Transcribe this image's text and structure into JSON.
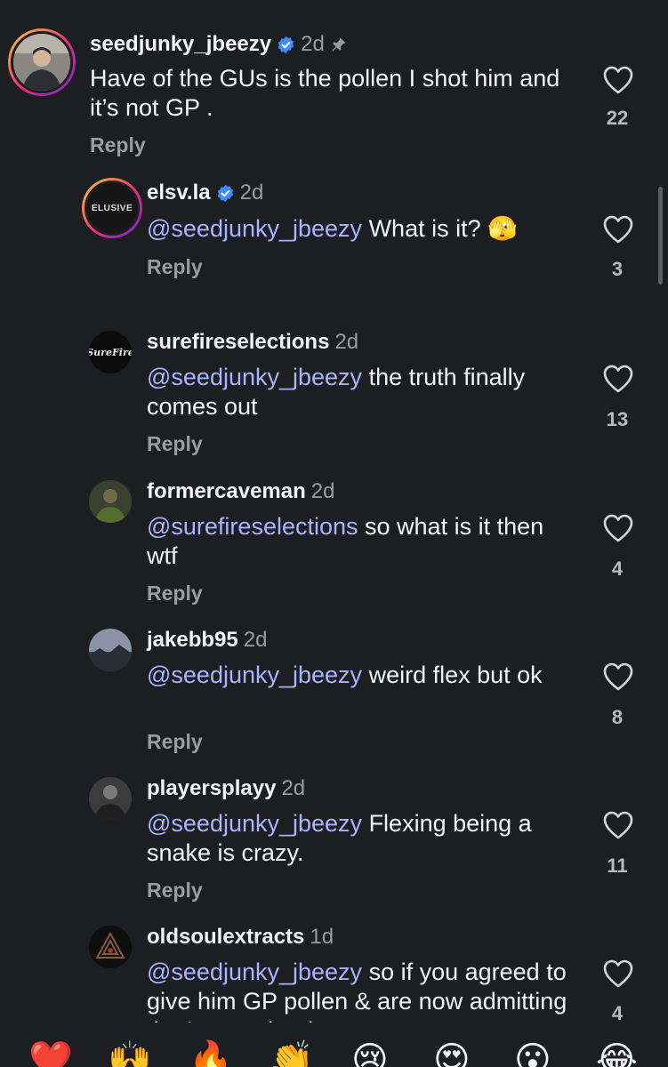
{
  "reply_label": "Reply",
  "comments": [
    {
      "username": "seedjunky_jbeezy",
      "verified": true,
      "time": "2d",
      "pinned": true,
      "mention": "",
      "text": "Have of the GUs is the pollen I shot him and it’s not GP .",
      "likes": "22",
      "avatar_icon": "man-portrait"
    },
    {
      "username": "elsv.la",
      "verified": true,
      "time": "2d",
      "mention": "@seedjunky_jbeezy",
      "text": " What is it? 🫣",
      "likes": "3",
      "avatar_icon": "elusive-logo",
      "avatar_text": "ELUSIVE"
    },
    {
      "username": "surefireselections",
      "time": "2d",
      "mention": "@seedjunky_jbeezy",
      "text": " the truth finally comes out",
      "likes": "13",
      "avatar_icon": "surefire-logo",
      "avatar_text": "SureFire"
    },
    {
      "username": "formercaveman",
      "time": "2d",
      "mention": "@surefireselections",
      "text": " so what is it then wtf",
      "likes": "4",
      "avatar_icon": "person-photo"
    },
    {
      "username": "jakebb95",
      "time": "2d",
      "mention": "@seedjunky_jbeezy",
      "text": " weird flex but ok",
      "likes": "8",
      "avatar_icon": "landscape-photo"
    },
    {
      "username": "playersplayy",
      "time": "2d",
      "mention": "@seedjunky_jbeezy",
      "text": " Flexing being a snake is crazy.",
      "likes": "11",
      "avatar_icon": "person-photo"
    },
    {
      "username": "oldsoulextracts",
      "time": "1d",
      "mention": "@seedjunky_jbeezy",
      "text": " so if you agreed to give him GP pollen & are now admitting that’s not what it",
      "likes": "4",
      "avatar_icon": "triangle-logo"
    }
  ],
  "emoji_bar": [
    "❤️",
    "🙌",
    "🔥",
    "👏",
    "😢",
    "😍",
    "😮",
    "😂"
  ],
  "colors": {
    "background": "#1c1e22",
    "mention": "#a9b3ff",
    "muted": "#9a9ca2",
    "verified": "#3d8bfd"
  }
}
